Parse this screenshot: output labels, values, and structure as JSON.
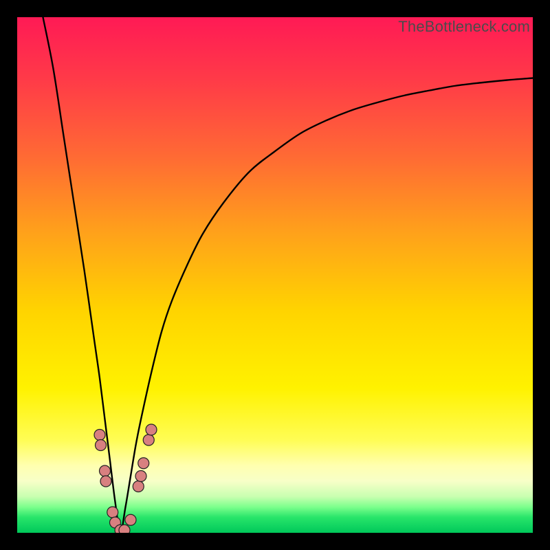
{
  "watermark": "TheBottleneck.com",
  "colors": {
    "frame": "#000000",
    "dot_fill": "#d88080",
    "dot_stroke": "#222222",
    "curve": "#000000"
  },
  "chart_data": {
    "type": "line",
    "title": "",
    "xlabel": "",
    "ylabel": "",
    "xlim": [
      0,
      100
    ],
    "ylim": [
      0,
      100
    ],
    "note": "Axes are implicit (no tick labels in source image). x ≈ component score, y ≈ bottleneck %. Curve minimum (zero bottleneck) near x ≈ 20.",
    "series": [
      {
        "name": "bottleneck-curve",
        "x": [
          5,
          7,
          9,
          11,
          13,
          15,
          16,
          17,
          18,
          19,
          20,
          21,
          22,
          23,
          24,
          26,
          28,
          30,
          33,
          36,
          40,
          45,
          50,
          55,
          60,
          65,
          70,
          75,
          80,
          85,
          90,
          95,
          100
        ],
        "y": [
          100,
          90,
          77,
          64,
          51,
          37,
          30,
          22,
          14,
          6,
          0,
          5,
          11,
          17,
          22,
          31,
          39,
          45,
          52,
          58,
          64,
          70,
          74,
          77.5,
          80,
          82,
          83.5,
          84.8,
          85.8,
          86.7,
          87.3,
          87.8,
          88.2
        ]
      }
    ],
    "markers": [
      {
        "x": 16.0,
        "y": 19.0
      },
      {
        "x": 16.2,
        "y": 17.0
      },
      {
        "x": 17.0,
        "y": 12.0
      },
      {
        "x": 17.2,
        "y": 10.0
      },
      {
        "x": 18.5,
        "y": 4.0
      },
      {
        "x": 19.0,
        "y": 2.0
      },
      {
        "x": 20.0,
        "y": 0.5
      },
      {
        "x": 20.8,
        "y": 0.5
      },
      {
        "x": 22.0,
        "y": 2.5
      },
      {
        "x": 23.5,
        "y": 9.0
      },
      {
        "x": 24.0,
        "y": 11.0
      },
      {
        "x": 24.5,
        "y": 13.5
      },
      {
        "x": 25.5,
        "y": 18.0
      },
      {
        "x": 26.0,
        "y": 20.0
      }
    ],
    "marker_radius_px": 8
  }
}
